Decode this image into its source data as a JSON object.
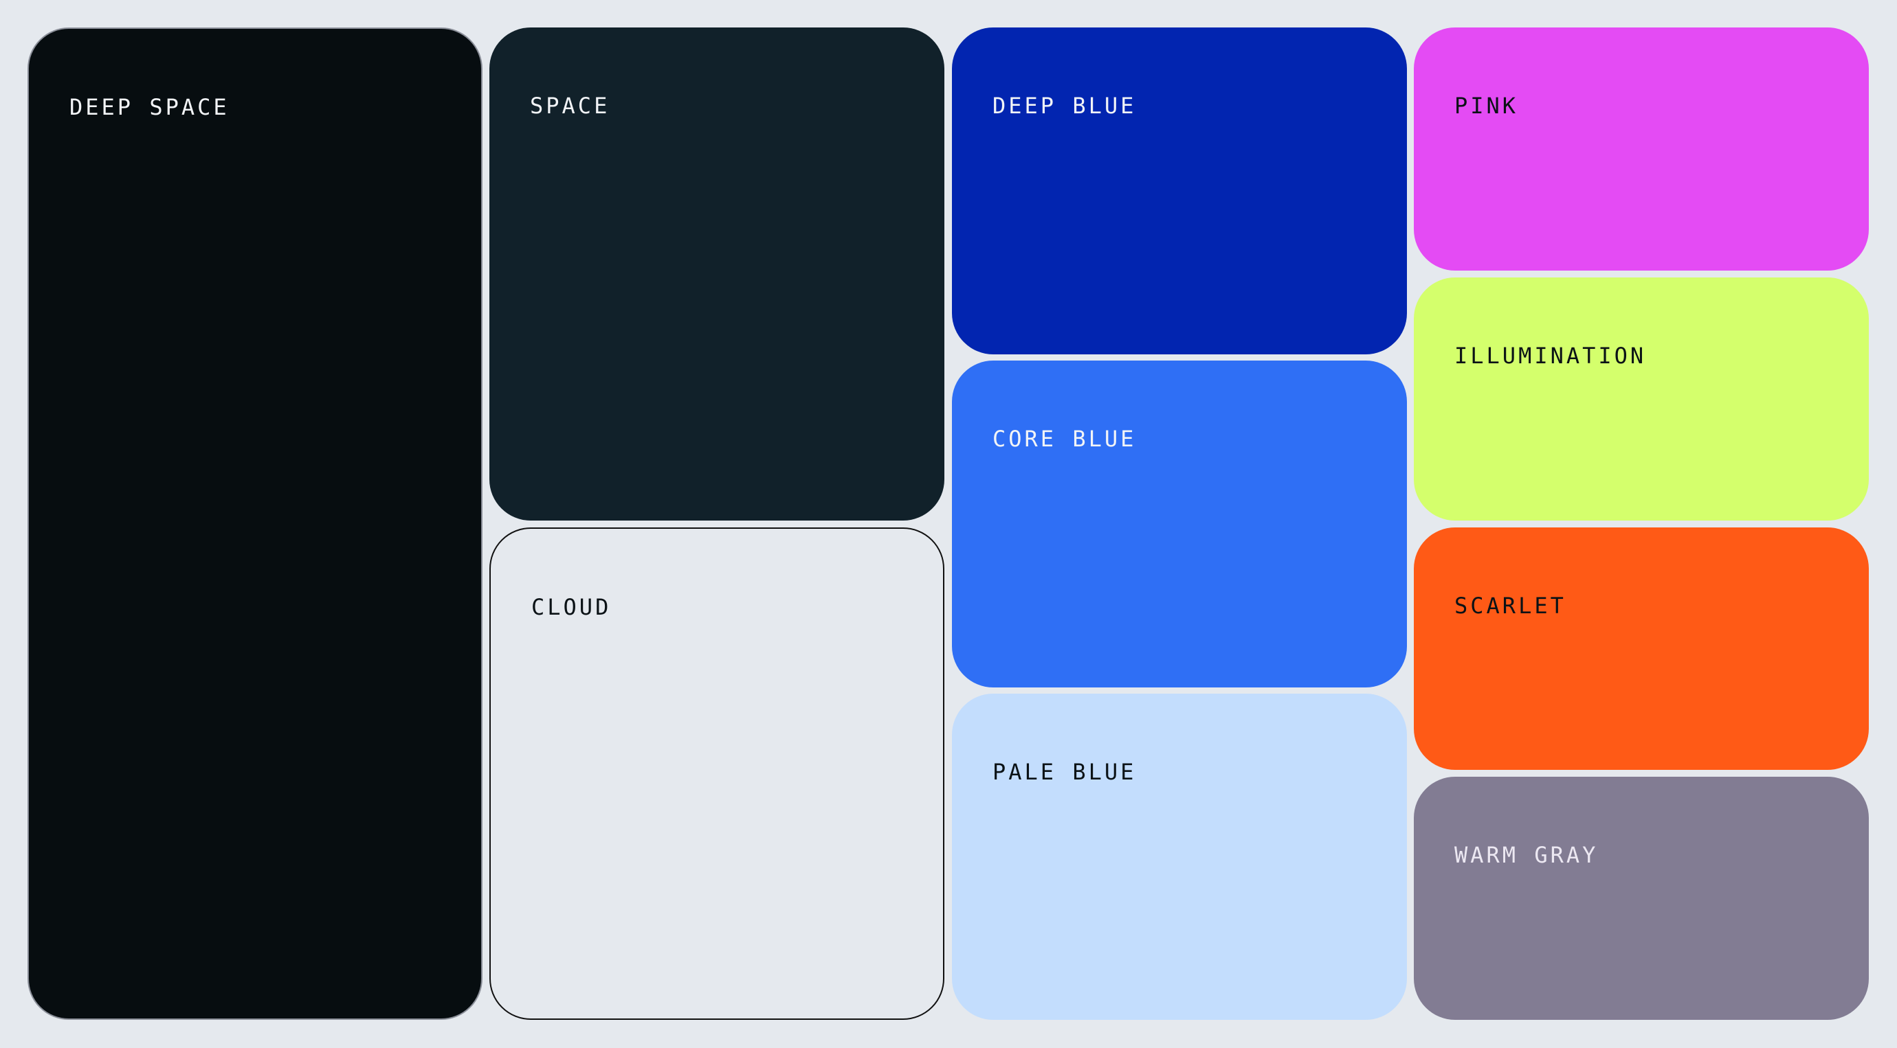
{
  "palette": {
    "swatches": [
      {
        "id": "deep_space",
        "label": "DEEP SPACE",
        "color": "#070d10"
      },
      {
        "id": "space",
        "label": "SPACE",
        "color": "#11212a"
      },
      {
        "id": "cloud",
        "label": "CLOUD",
        "color": "#e5e9ee"
      },
      {
        "id": "deep_blue",
        "label": "DEEP BLUE",
        "color": "#0225b0"
      },
      {
        "id": "core_blue",
        "label": "CORE BLUE",
        "color": "#2f6ff5"
      },
      {
        "id": "pale_blue",
        "label": "PALE BLUE",
        "color": "#c3ddfd"
      },
      {
        "id": "pink",
        "label": "PINK",
        "color": "#e44bf4"
      },
      {
        "id": "illumination",
        "label": "ILLUMINATION",
        "color": "#d4ff6c"
      },
      {
        "id": "scarlet",
        "label": "SCARLET",
        "color": "#ff5a16"
      },
      {
        "id": "warm_gray",
        "label": "WARM GRAY",
        "color": "#827c93"
      }
    ]
  }
}
